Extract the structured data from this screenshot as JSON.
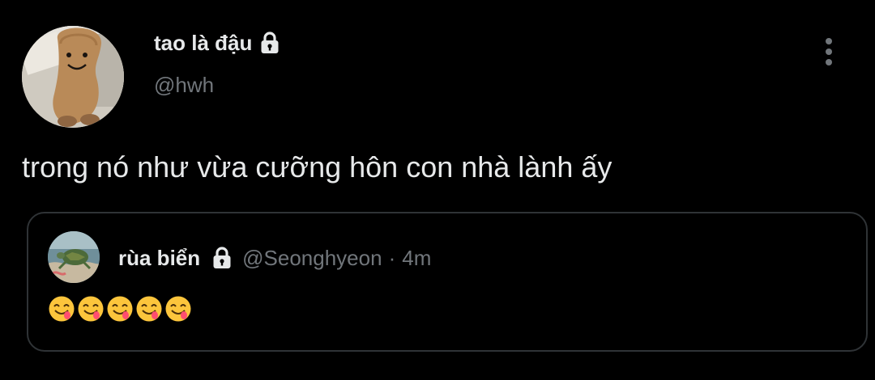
{
  "tweet": {
    "author": {
      "display_name": "tao là đậu",
      "handle": "@hwh",
      "protected_icon": "lock-icon",
      "avatar": "peanut-plush-avatar"
    },
    "text": "trong nó như vừa cưỡng hôn con nhà lành ấy",
    "more_icon": "more-vertical-icon",
    "quoted_tweet": {
      "display_name": "rùa biển",
      "protected_icon": "lock-icon",
      "handle": "@Seonghyeon",
      "separator": "·",
      "time": "4m",
      "avatar": "sea-turtle-avatar",
      "emojis": [
        "😋",
        "😋",
        "😋",
        "😋",
        "😋"
      ]
    }
  },
  "colors": {
    "background": "#000000",
    "primary_text": "#e7e9ea",
    "secondary_text": "#71767b",
    "border": "#2f3336"
  }
}
